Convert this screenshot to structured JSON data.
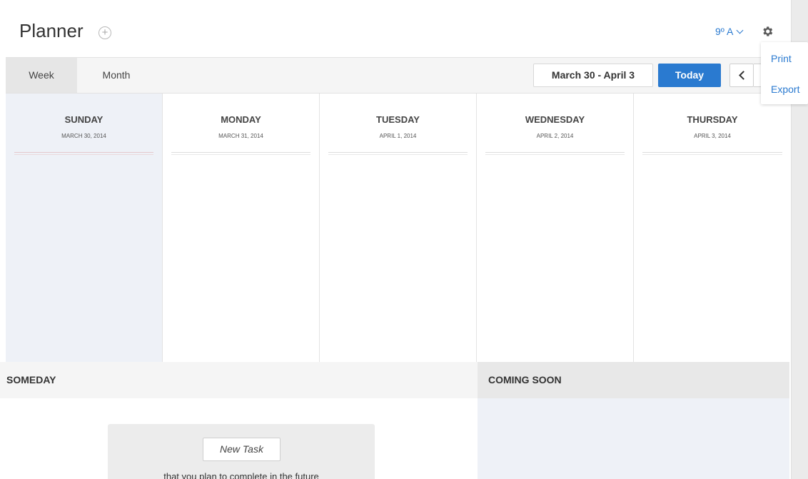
{
  "header": {
    "title": "Planner",
    "add_icon_glyph": "+",
    "class_selector": "9º A",
    "gear_icon": "gear-icon"
  },
  "toolbar": {
    "tabs": [
      {
        "label": "Week",
        "active": true
      },
      {
        "label": "Month",
        "active": false
      }
    ],
    "date_range": "March 30 - April 3",
    "today_label": "Today"
  },
  "menu": {
    "items": [
      "Print",
      "Export"
    ]
  },
  "week": {
    "days": [
      {
        "name": "SUNDAY",
        "date": "MARCH 30, 2014",
        "current": true
      },
      {
        "name": "MONDAY",
        "date": "MARCH 31, 2014",
        "current": false
      },
      {
        "name": "TUESDAY",
        "date": "APRIL 1, 2014",
        "current": false
      },
      {
        "name": "WEDNESDAY",
        "date": "APRIL 2, 2014",
        "current": false
      },
      {
        "name": "THURSDAY",
        "date": "APRIL 3, 2014",
        "current": false
      }
    ]
  },
  "someday": {
    "title": "SOMEDAY",
    "new_task_label": "New Task",
    "hint": "that you plan to complete in the future"
  },
  "coming_soon": {
    "title": "COMING SOON"
  },
  "colors": {
    "accent": "#2a7ad0",
    "current_day_bg": "#eef1f7"
  }
}
